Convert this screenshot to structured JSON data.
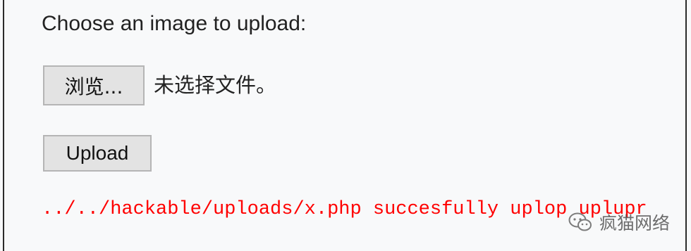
{
  "form": {
    "prompt": "Choose an image to upload:",
    "browse_label": "浏览...",
    "no_file_text": "未选择文件。",
    "upload_label": "Upload"
  },
  "status": {
    "message": "../../hackable/uploads/x.php succesfully uplop uplupr",
    "color": "#ff0000"
  },
  "watermark": {
    "icon": "wechat-icon",
    "text": "疯猫网络"
  }
}
